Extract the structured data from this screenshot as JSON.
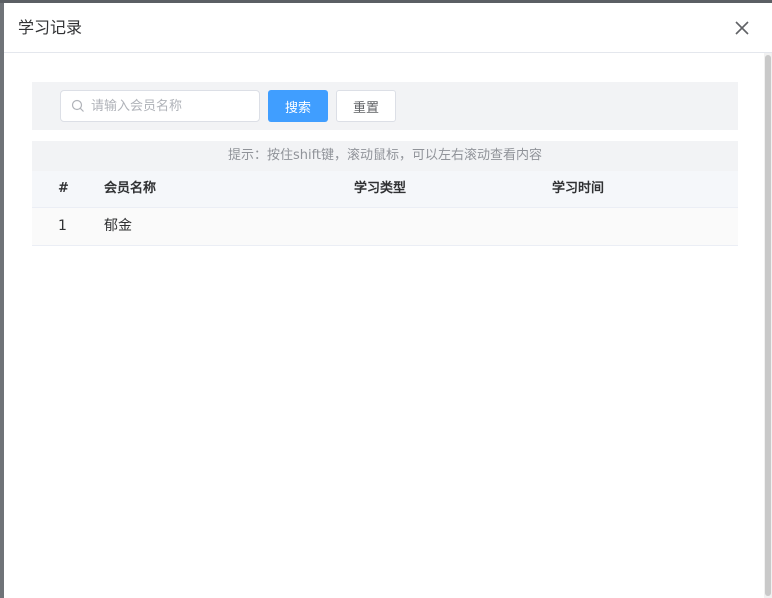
{
  "dialog": {
    "title": "学习记录",
    "close_icon": "close-icon"
  },
  "search": {
    "placeholder": "请输入会员名称",
    "value": "",
    "search_label": "搜索",
    "reset_label": "重置",
    "icon": "search-icon"
  },
  "hint": "提示：按住shift键，滚动鼠标，可以左右滚动查看内容",
  "table": {
    "columns": [
      "#",
      "会员名称",
      "学习类型",
      "学习时间"
    ],
    "rows": [
      {
        "index": "1",
        "member_name": "郁金",
        "study_type": "",
        "study_time": ""
      }
    ]
  },
  "colors": {
    "primary": "#409eff",
    "header_bg": "#f5f7fa",
    "toolbar_bg": "#f2f3f5"
  }
}
